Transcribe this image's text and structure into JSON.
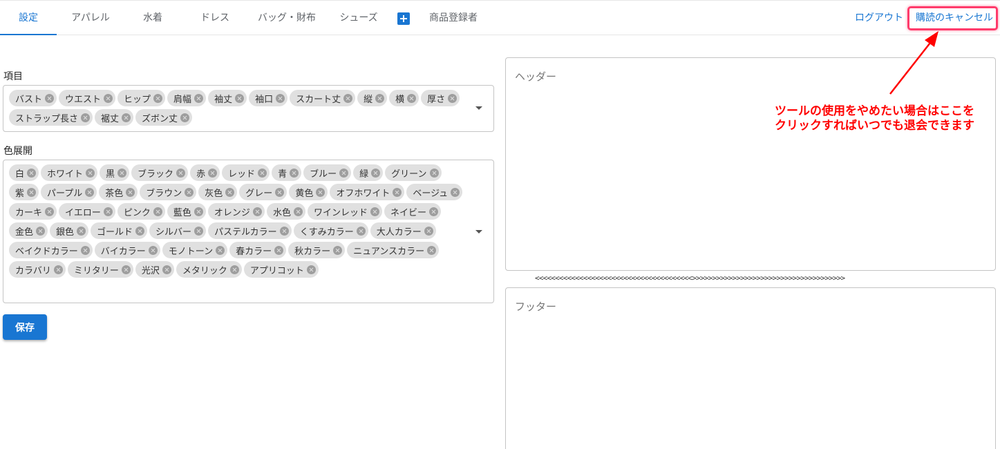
{
  "nav": {
    "tabs": [
      {
        "label": "設定",
        "active": true
      },
      {
        "label": "アパレル"
      },
      {
        "label": "水着"
      },
      {
        "label": "ドレス"
      },
      {
        "label": "バッグ・財布"
      },
      {
        "label": "シューズ"
      }
    ],
    "add_icon": "plus-icon",
    "registrant_label": "商品登録者",
    "logout_label": "ログアウト",
    "cancel_label": "購読のキャンセル"
  },
  "form": {
    "items_label": "項目",
    "items": [
      "バスト",
      "ウエスト",
      "ヒップ",
      "肩幅",
      "袖丈",
      "袖口",
      "スカート丈",
      "縦",
      "横",
      "厚さ",
      "ストラップ長さ",
      "裾丈",
      "ズボン丈"
    ],
    "colors_label": "色展開",
    "colors": [
      "白",
      "ホワイト",
      "黒",
      "ブラック",
      "赤",
      "レッド",
      "青",
      "ブルー",
      "緑",
      "グリーン",
      "紫",
      "パープル",
      "茶色",
      "ブラウン",
      "灰色",
      "グレー",
      "黄色",
      "オフホワイト",
      "ベージュ",
      "カーキ",
      "イエロー",
      "ピンク",
      "藍色",
      "オレンジ",
      "水色",
      "ワインレッド",
      "ネイビー",
      "金色",
      "銀色",
      "ゴールド",
      "シルバー",
      "パステルカラー",
      "くすみカラー",
      "大人カラー",
      "ベイクドカラー",
      "バイカラー",
      "モノトーン",
      "春カラー",
      "秋カラー",
      "ニュアンスカラー",
      "カラバリ",
      "ミリタリー",
      "光沢",
      "メタリック",
      "アプリコット"
    ],
    "save_label": "保存"
  },
  "editor": {
    "header_placeholder": "ヘッダー",
    "divider": "<<<<<<<<<<<<<<<<<<<<<<<<<<<<<<<<<<<<<<<>>>>>>>>>>>>>>>>>>>>>>>>>>>>>>>>>>>>>>",
    "footer_placeholder": "フッター"
  },
  "annotation": {
    "line1": "ツールの使用をやめたい場合はここを",
    "line2": "クリックすればいつでも退会できます",
    "color": "#ff0000"
  },
  "colors": {
    "accent": "#1976d2",
    "chip_bg": "#e0e0e0",
    "highlight": "#ff3b6b"
  }
}
